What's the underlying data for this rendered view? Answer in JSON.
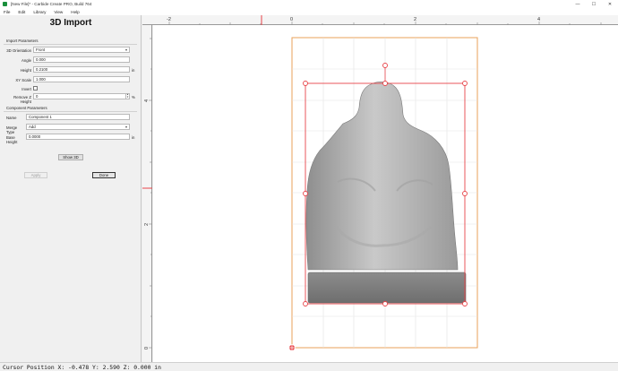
{
  "window": {
    "title": "[New File]* - Carbide Create PRO, Build 764",
    "controls": [
      "—",
      "☐",
      "✕"
    ]
  },
  "menu": [
    "File",
    "Edit",
    "Library",
    "View",
    "Help"
  ],
  "panel": {
    "title": "3D Import",
    "import_section": "Import Parameters",
    "orientation_label": "3D Orientation",
    "orientation_value": "Front",
    "angle_label": "Angle",
    "angle_value": "0.000",
    "height_label": "Height",
    "height_value": "0.2100",
    "height_unit": "in",
    "xy_scale_label": "XY Scale",
    "xy_scale_value": "1.000",
    "invert_label": "Invert",
    "remove_z_label": "Remove Z Height",
    "remove_z_value": "0",
    "remove_z_unit": "%",
    "component_section": "Component Parameters",
    "name_label": "Name",
    "name_value": "Component 1",
    "merge_label": "Merge Type",
    "merge_value": "Add",
    "base_height_label": "Base Height",
    "base_height_value": "0.0000",
    "base_height_unit": "in",
    "show3d_label": "Show 3D",
    "apply_label": "Apply",
    "done_label": "Done"
  },
  "ruler": {
    "top_ticks": [
      "-2",
      "0",
      "2",
      "4"
    ],
    "left_ticks": [
      "4",
      "2",
      "0"
    ]
  },
  "status": {
    "text": "Cursor Position X: -0.478 Y: 2.590 Z: 0.000 in"
  },
  "colors": {
    "selection": "#e8454a",
    "stock_border": "#e8a05a",
    "grid": "#e3e3e3"
  }
}
